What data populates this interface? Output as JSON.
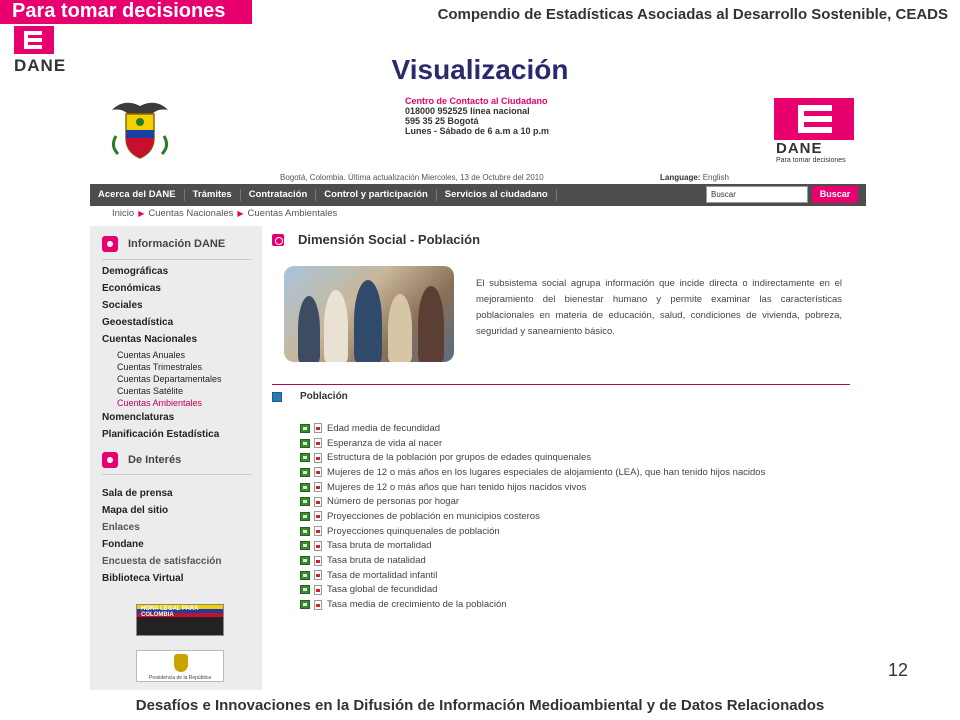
{
  "slide": {
    "banner": "Para tomar decisiones",
    "logo_text": "DANE",
    "header": "Compendio de Estadísticas Asociadas al  Desarrollo Sostenible, CEADS",
    "title": "Visualización",
    "page_number": "12",
    "footer": "Desafíos e Innovaciones en la Difusión de Información Medioambiental y de Datos Relacionados"
  },
  "web": {
    "contact": {
      "title": "Centro de Contacto al Ciudadano",
      "line1": "018000  952525 línea nacional",
      "line2": "595 35 25 Bogotá",
      "line3": "Lunes - Sábado de 6 a.m a 10 p.m"
    },
    "logo": {
      "name": "DANE",
      "tagline": "Para tomar decisiones"
    },
    "updated": "Bogotá, Colombia. Última actualización Miercoles, 13 de Octubre del 2010",
    "language_label": "Language:",
    "language_value": "English",
    "nav": [
      "Acerca del DANE",
      "Trámites",
      "Contratación",
      "Control y participación",
      "Servicios al ciudadano"
    ],
    "search": {
      "placeholder": "Buscar",
      "button": "Buscar"
    },
    "breadcrumb": [
      "Inicio",
      "Cuentas Nacionales",
      "Cuentas Ambientales"
    ],
    "sidebar": {
      "section1_title": "Información DANE",
      "links1": [
        "Demográficas",
        "Económicas",
        "Sociales",
        "Geoestadística",
        "Cuentas Nacionales"
      ],
      "sublinks": [
        "Cuentas Anuales",
        "Cuentas Trimestrales",
        "Cuentas Departamentales",
        "Cuentas Satélite",
        "Cuentas Ambientales"
      ],
      "links2": [
        "Nomenclaturas",
        "Planificación Estadística"
      ],
      "section2_title": "De Interés",
      "links3": [
        "Sala de prensa",
        "Mapa del sitio",
        "Enlaces",
        "Fondane",
        "Encuesta de satisfacción",
        "Biblioteca Virtual"
      ],
      "banner1": "HORA LEGAL PARA COLOMBIA",
      "banner2": "Presidencia de la República"
    },
    "main": {
      "title": "Dimensión Social - Población",
      "description": "El subsistema social agrupa información que incide directa o indirectamente en el mejoramiento del bienestar humano y permite examinar las características poblacionales en materia de educación, salud, condiciones de vivienda, pobreza, seguridad y saneamiento básico.",
      "section_title": "Población",
      "items": [
        "Edad media de fecundidad",
        "Esperanza de vida al nacer",
        "Estructura de la población por grupos de edades quinquenales",
        "Mujeres de 12 o más años en los lugares especiales de alojamiento (LEA), que han tenido hijos nacidos",
        "Mujeres de 12 o más años que han tenido hijos nacidos vivos",
        "Número de personas por hogar",
        "Proyecciones de población en municipios costeros",
        "Proyecciones quinquenales de población",
        "Tasa bruta de mortalidad",
        "Tasa bruta de natalidad",
        "Tasa de mortalidad infantil",
        "Tasa global de fecundidad",
        "Tasa media de crecimiento de la población"
      ]
    }
  }
}
